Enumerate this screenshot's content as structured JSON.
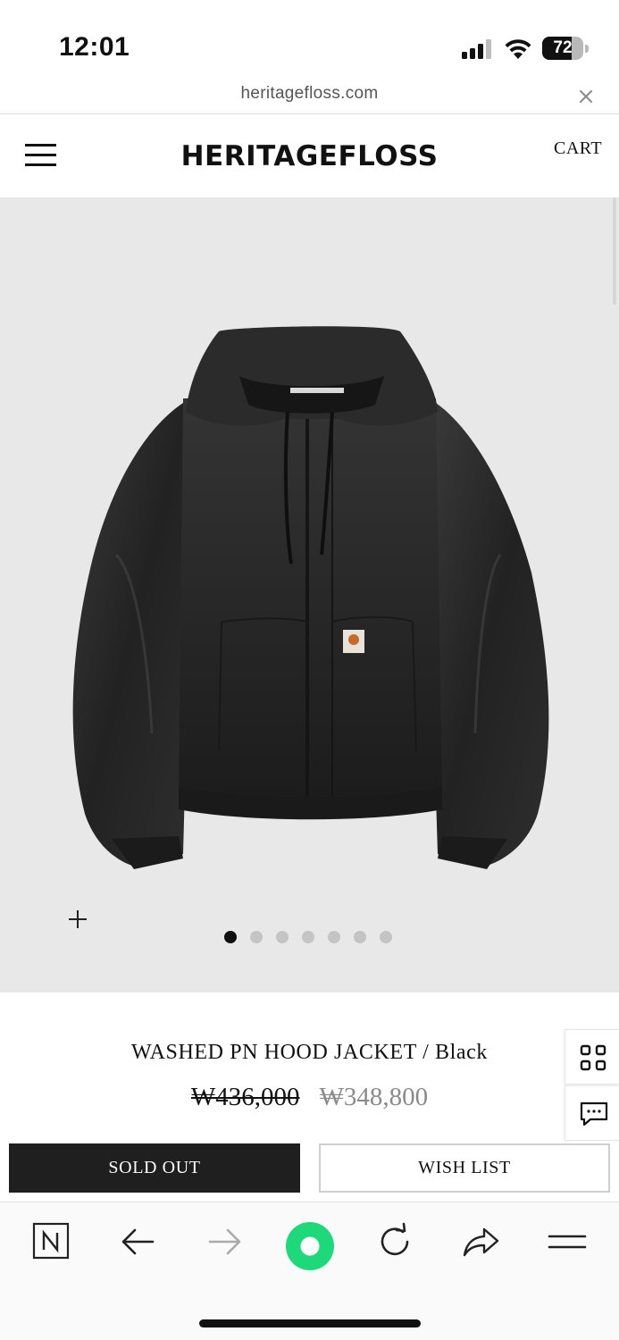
{
  "status_bar": {
    "time": "12:01",
    "battery_level": "72",
    "battery_fraction": 0.72
  },
  "url_bar": {
    "domain": "heritagefloss.com",
    "close_icon": "close-icon"
  },
  "header": {
    "menu_icon": "hamburger-menu-icon",
    "logo": "HERITAGEFLOSS",
    "cart_label": "CART"
  },
  "gallery": {
    "zoom_icon": "plus-icon",
    "slide_count": 7,
    "active_slide": 1
  },
  "product": {
    "name": "WASHED PN HOOD JACKET / Black",
    "original_price": "₩436,000",
    "sale_price": "₩348,800"
  },
  "side_buttons": {
    "grid_icon": "grid-icon",
    "chat_icon": "chat-icon"
  },
  "actions": {
    "sold_out_label": "SOLD OUT",
    "wish_list_label": "WISH LIST"
  },
  "browser_toolbar": {
    "items": [
      "naver-n-icon",
      "back-arrow-icon",
      "forward-arrow-icon",
      "green-circle-icon",
      "reload-icon",
      "share-icon",
      "menu-icon"
    ]
  },
  "colors": {
    "image_bg": "#e8e8e8",
    "sold_out_bg": "#1f1f1f",
    "accent_green": "#1ed97a"
  }
}
